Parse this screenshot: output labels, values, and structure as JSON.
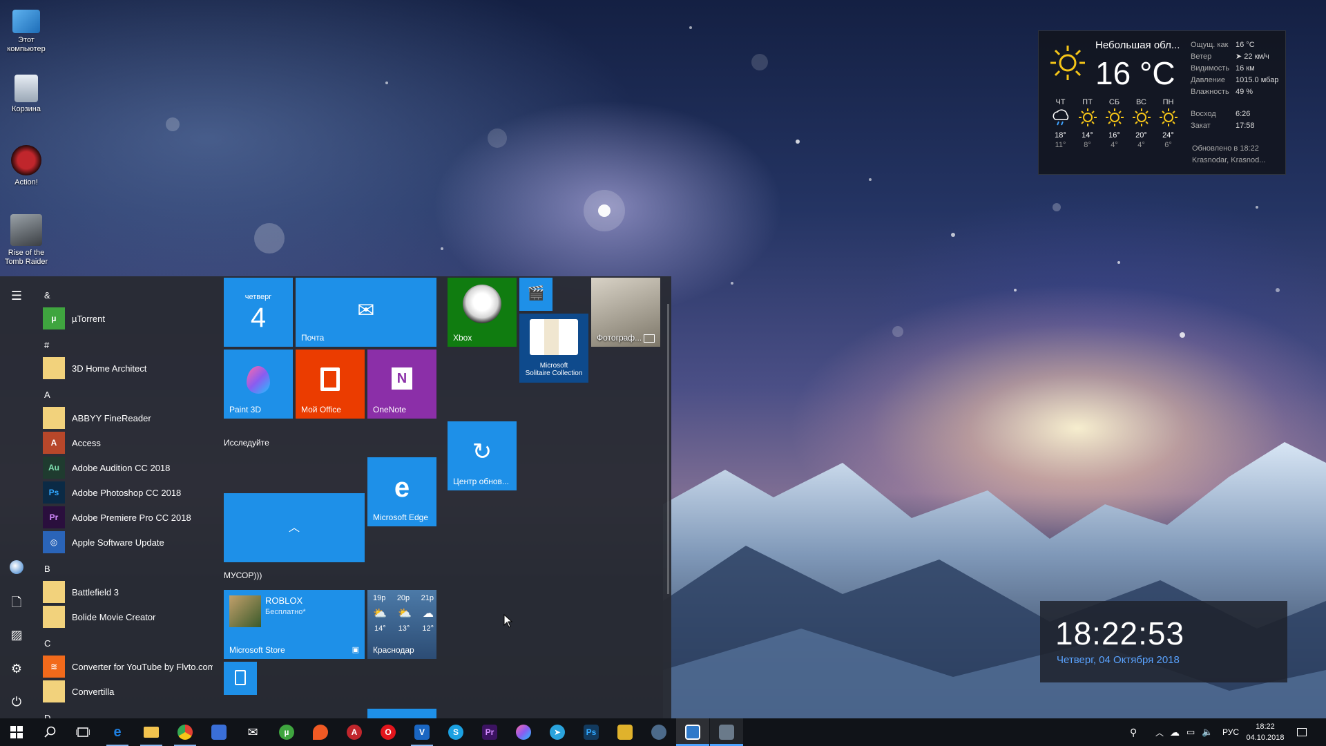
{
  "desktop": {
    "icons": [
      {
        "label": "Этот компьютер",
        "icon": "computer-icon"
      },
      {
        "label": "Корзина",
        "icon": "recycle-bin-icon"
      },
      {
        "label": "Action!",
        "icon": "action-app-icon"
      },
      {
        "label": "Rise of the Tomb Raider",
        "icon": "game-icon"
      }
    ]
  },
  "weather": {
    "condition": "Небольшая обл...",
    "temperature": "16 °C",
    "details": [
      {
        "label": "Ощущ. как",
        "value": "16 °C"
      },
      {
        "label": "Ветер",
        "value": "➤ 22 км/ч"
      },
      {
        "label": "Видимость",
        "value": "16 км"
      },
      {
        "label": "Давление",
        "value": "1015.0 мбар"
      },
      {
        "label": "Влажность",
        "value": "49 %"
      }
    ],
    "forecast": [
      {
        "day": "ЧТ",
        "hi": "18°",
        "lo": "11°",
        "icon": "rain-cloud-icon"
      },
      {
        "day": "ПТ",
        "hi": "14°",
        "lo": "8°",
        "icon": "sun-icon"
      },
      {
        "day": "СБ",
        "hi": "16°",
        "lo": "4°",
        "icon": "sun-icon"
      },
      {
        "day": "ВС",
        "hi": "20°",
        "lo": "4°",
        "icon": "sun-icon"
      },
      {
        "day": "ПН",
        "hi": "24°",
        "lo": "6°",
        "icon": "sun-icon"
      }
    ],
    "sunrise_label": "Восход",
    "sunrise": "6:26",
    "sunset_label": "Закат",
    "sunset": "17:58",
    "updated": "Обновлено в 18:22",
    "location": "Krasnodar, Krasnod..."
  },
  "clock_widget": {
    "time": "18:22:53",
    "date": "Четверг, 04 Октября 2018"
  },
  "start_menu": {
    "rail": [
      "hamburger-icon",
      "user-avatar-icon",
      "document-icon",
      "pictures-icon",
      "settings-icon",
      "power-icon"
    ],
    "sections": [
      {
        "letter": "&",
        "apps": [
          {
            "name": "µTorrent",
            "icon": "utorrent-icon",
            "color": "#3fa53f",
            "folder": false
          }
        ]
      },
      {
        "letter": "#",
        "apps": [
          {
            "name": "3D Home Architect",
            "icon": "folder-icon",
            "color": "#f2d27c",
            "folder": true
          }
        ]
      },
      {
        "letter": "A",
        "apps": [
          {
            "name": "ABBYY FineReader",
            "icon": "folder-icon",
            "color": "#f2d27c",
            "folder": true
          },
          {
            "name": "Access",
            "icon": "access-icon",
            "color": "#b7472a",
            "folder": false
          },
          {
            "name": "Adobe Audition CC 2018",
            "icon": "audition-icon",
            "color": "#1f3b2f",
            "folder": false
          },
          {
            "name": "Adobe Photoshop CC 2018",
            "icon": "photoshop-icon",
            "color": "#0b2a45",
            "folder": false
          },
          {
            "name": "Adobe Premiere Pro CC 2018",
            "icon": "premiere-icon",
            "color": "#2a0f3d",
            "folder": false
          },
          {
            "name": "Apple Software Update",
            "icon": "apple-update-icon",
            "color": "#2a64b8",
            "folder": false
          }
        ]
      },
      {
        "letter": "B",
        "apps": [
          {
            "name": "Battlefield 3",
            "icon": "folder-icon",
            "color": "#f2d27c",
            "folder": true
          },
          {
            "name": "Bolide Movie Creator",
            "icon": "folder-icon",
            "color": "#f2d27c",
            "folder": true
          }
        ]
      },
      {
        "letter": "C",
        "apps": [
          {
            "name": "Converter for YouTube by Flvto.com",
            "icon": "converter-icon",
            "color": "#f26a1b",
            "folder": false
          },
          {
            "name": "Convertilla",
            "icon": "folder-icon",
            "color": "#f2d27c",
            "folder": true
          }
        ]
      },
      {
        "letter": "D",
        "apps": []
      }
    ],
    "tiles": {
      "calendar_day": "четверг",
      "calendar_date": "4",
      "mail": "Почта",
      "xbox": "Xbox",
      "photos": "Фотограф...",
      "solitaire_line1": "Microsoft",
      "solitaire_line2": "Solitaire Collection",
      "paint3d": "Paint 3D",
      "office": "Мой Office",
      "onenote": "OneNote",
      "group_explore": "Исследуйте",
      "edge": "Microsoft Edge",
      "update_center": "Центр обнов...",
      "group_trash": "МУСОР)))",
      "store_title": "ROBLOX",
      "store_sub": "Бесплатно*",
      "store_label": "Microsoft Store",
      "weather_hours": [
        "19p",
        "20p",
        "21p"
      ],
      "weather_temps": [
        "14°",
        "13°",
        "12°"
      ],
      "weather_city": "Краснодар"
    }
  },
  "taskbar": {
    "apps": [
      {
        "name": "start-button",
        "glyph": "",
        "color": "#ffffff"
      },
      {
        "name": "search-icon",
        "glyph": "",
        "color": "#ffffff"
      },
      {
        "name": "task-view-icon",
        "glyph": "",
        "color": "#ffffff"
      },
      {
        "name": "edge-icon",
        "glyph": "e",
        "color": "#1e7fe0"
      },
      {
        "name": "file-explorer-icon",
        "glyph": "",
        "color": "#f2c34e"
      },
      {
        "name": "chrome-icon",
        "glyph": "",
        "color": "#e34133"
      },
      {
        "name": "store-icon",
        "glyph": "",
        "color": "#3a6fd8"
      },
      {
        "name": "mail-icon",
        "glyph": "",
        "color": "#ffffff"
      },
      {
        "name": "utorrent-icon",
        "glyph": "µ",
        "color": "#3fa53f"
      },
      {
        "name": "maps-icon",
        "glyph": "",
        "color": "#f05a24"
      },
      {
        "name": "action-icon",
        "glyph": "A",
        "color": "#c0262c"
      },
      {
        "name": "opera-icon",
        "glyph": "O",
        "color": "#e3151c"
      },
      {
        "name": "vegas-icon",
        "glyph": "V",
        "color": "#1a66c2"
      },
      {
        "name": "skype-icon",
        "glyph": "S",
        "color": "#1ba1e2"
      },
      {
        "name": "premiere-icon",
        "glyph": "Pr",
        "color": "#3c1361"
      },
      {
        "name": "paint3d-icon",
        "glyph": "",
        "color": "#b84fd8"
      },
      {
        "name": "telegram-icon",
        "glyph": "",
        "color": "#2aa3dc"
      },
      {
        "name": "photoshop-icon",
        "glyph": "Ps",
        "color": "#123a5e"
      },
      {
        "name": "folder-game-icon",
        "glyph": "",
        "color": "#e0b22c"
      },
      {
        "name": "steam-icon",
        "glyph": "",
        "color": "#4c6a8a"
      },
      {
        "name": "system-app-icon",
        "glyph": "",
        "color": "#2f79c9"
      },
      {
        "name": "desktop-app-icon",
        "glyph": "",
        "color": "#6a7a8a"
      }
    ],
    "language": "РУС",
    "time": "18:22",
    "date": "04.10.2018"
  }
}
